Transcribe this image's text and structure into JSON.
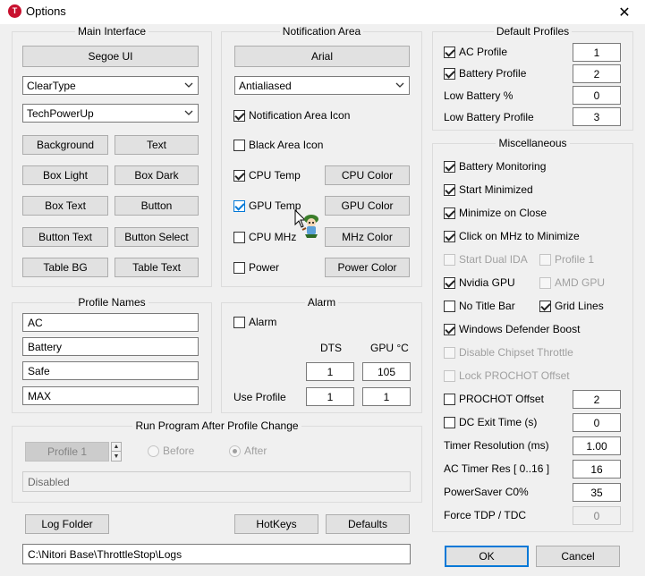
{
  "window": {
    "title": "Options",
    "icon": "T",
    "close": "✕"
  },
  "main_interface": {
    "title": "Main Interface",
    "font_button": "Segoe UI",
    "rendering": "ClearType",
    "theme": "TechPowerUp",
    "buttons": [
      "Background",
      "Text",
      "Box Light",
      "Box Dark",
      "Box Text",
      "Button",
      "Button Text",
      "Button Select",
      "Table BG",
      "Table Text"
    ]
  },
  "notification_area": {
    "title": "Notification Area",
    "font_button": "Arial",
    "rendering": "Antialiased",
    "notification_icon": {
      "label": "Notification Area Icon",
      "checked": true
    },
    "black_icon": {
      "label": "Black Area Icon",
      "checked": false
    },
    "rows": [
      {
        "label": "CPU Temp",
        "checked": true,
        "button": "CPU Color"
      },
      {
        "label": "GPU Temp",
        "checked": true,
        "button": "GPU Color"
      },
      {
        "label": "CPU MHz",
        "checked": false,
        "button": "MHz Color"
      },
      {
        "label": "Power",
        "checked": false,
        "button": "Power Color"
      }
    ]
  },
  "default_profiles": {
    "title": "Default Profiles",
    "ac_profile": {
      "label": "AC Profile",
      "checked": true,
      "value": "1"
    },
    "battery_profile": {
      "label": "Battery Profile",
      "checked": true,
      "value": "2"
    },
    "low_battery_pct": {
      "label": "Low Battery %",
      "value": "0"
    },
    "low_battery_profile": {
      "label": "Low Battery Profile",
      "value": "3"
    }
  },
  "misc": {
    "title": "Miscellaneous",
    "battery_monitoring": "Battery Monitoring",
    "start_minimized": "Start Minimized",
    "minimize_on_close": "Minimize on Close",
    "click_mhz": "Click on MHz to Minimize",
    "start_dual_ida": "Start Dual IDA",
    "profile_1": "Profile 1",
    "nvidia_gpu": "Nvidia GPU",
    "amd_gpu": "AMD GPU",
    "no_title_bar": "No Title Bar",
    "grid_lines": "Grid Lines",
    "defender_boost": "Windows Defender Boost",
    "disable_chipset": "Disable Chipset Throttle",
    "lock_prochot": "Lock PROCHOT Offset",
    "prochot_offset": {
      "label": "PROCHOT Offset",
      "value": "2"
    },
    "dc_exit_time": {
      "label": "DC Exit Time (s)",
      "value": "0"
    },
    "timer_resolution": {
      "label": "Timer Resolution (ms)",
      "value": "1.00"
    },
    "ac_timer_res": {
      "label": "AC Timer Res [ 0..16 ]",
      "value": "16"
    },
    "powersaver": {
      "label": "PowerSaver C0%",
      "value": "35"
    },
    "force_tdp": {
      "label": "Force TDP / TDC",
      "value": "0"
    }
  },
  "profile_names": {
    "title": "Profile Names",
    "names": [
      "AC",
      "Battery",
      "Safe",
      "MAX"
    ]
  },
  "alarm": {
    "title": "Alarm",
    "alarm_label": "Alarm",
    "dts_header": "DTS",
    "gpu_header": "GPU °C",
    "dts_value": "1",
    "gpu_value": "105",
    "use_profile_label": "Use Profile",
    "use_profile_dts": "1",
    "use_profile_gpu": "1"
  },
  "run_program": {
    "title": "Run Program After Profile Change",
    "profile_button": "Profile 1",
    "before": "Before",
    "after": "After",
    "path": "Disabled"
  },
  "bottom": {
    "log_folder": "Log Folder",
    "hotkeys": "HotKeys",
    "defaults": "Defaults",
    "log_path": "C:\\Nitori Base\\ThrottleStop\\Logs",
    "ok": "OK",
    "cancel": "Cancel"
  },
  "colors": {
    "accent": "#0078d7",
    "app_icon": "#c8102e"
  },
  "icons": [
    "app-icon",
    "close-icon",
    "chevron-down-icon",
    "mascot-sprite-icon"
  ]
}
